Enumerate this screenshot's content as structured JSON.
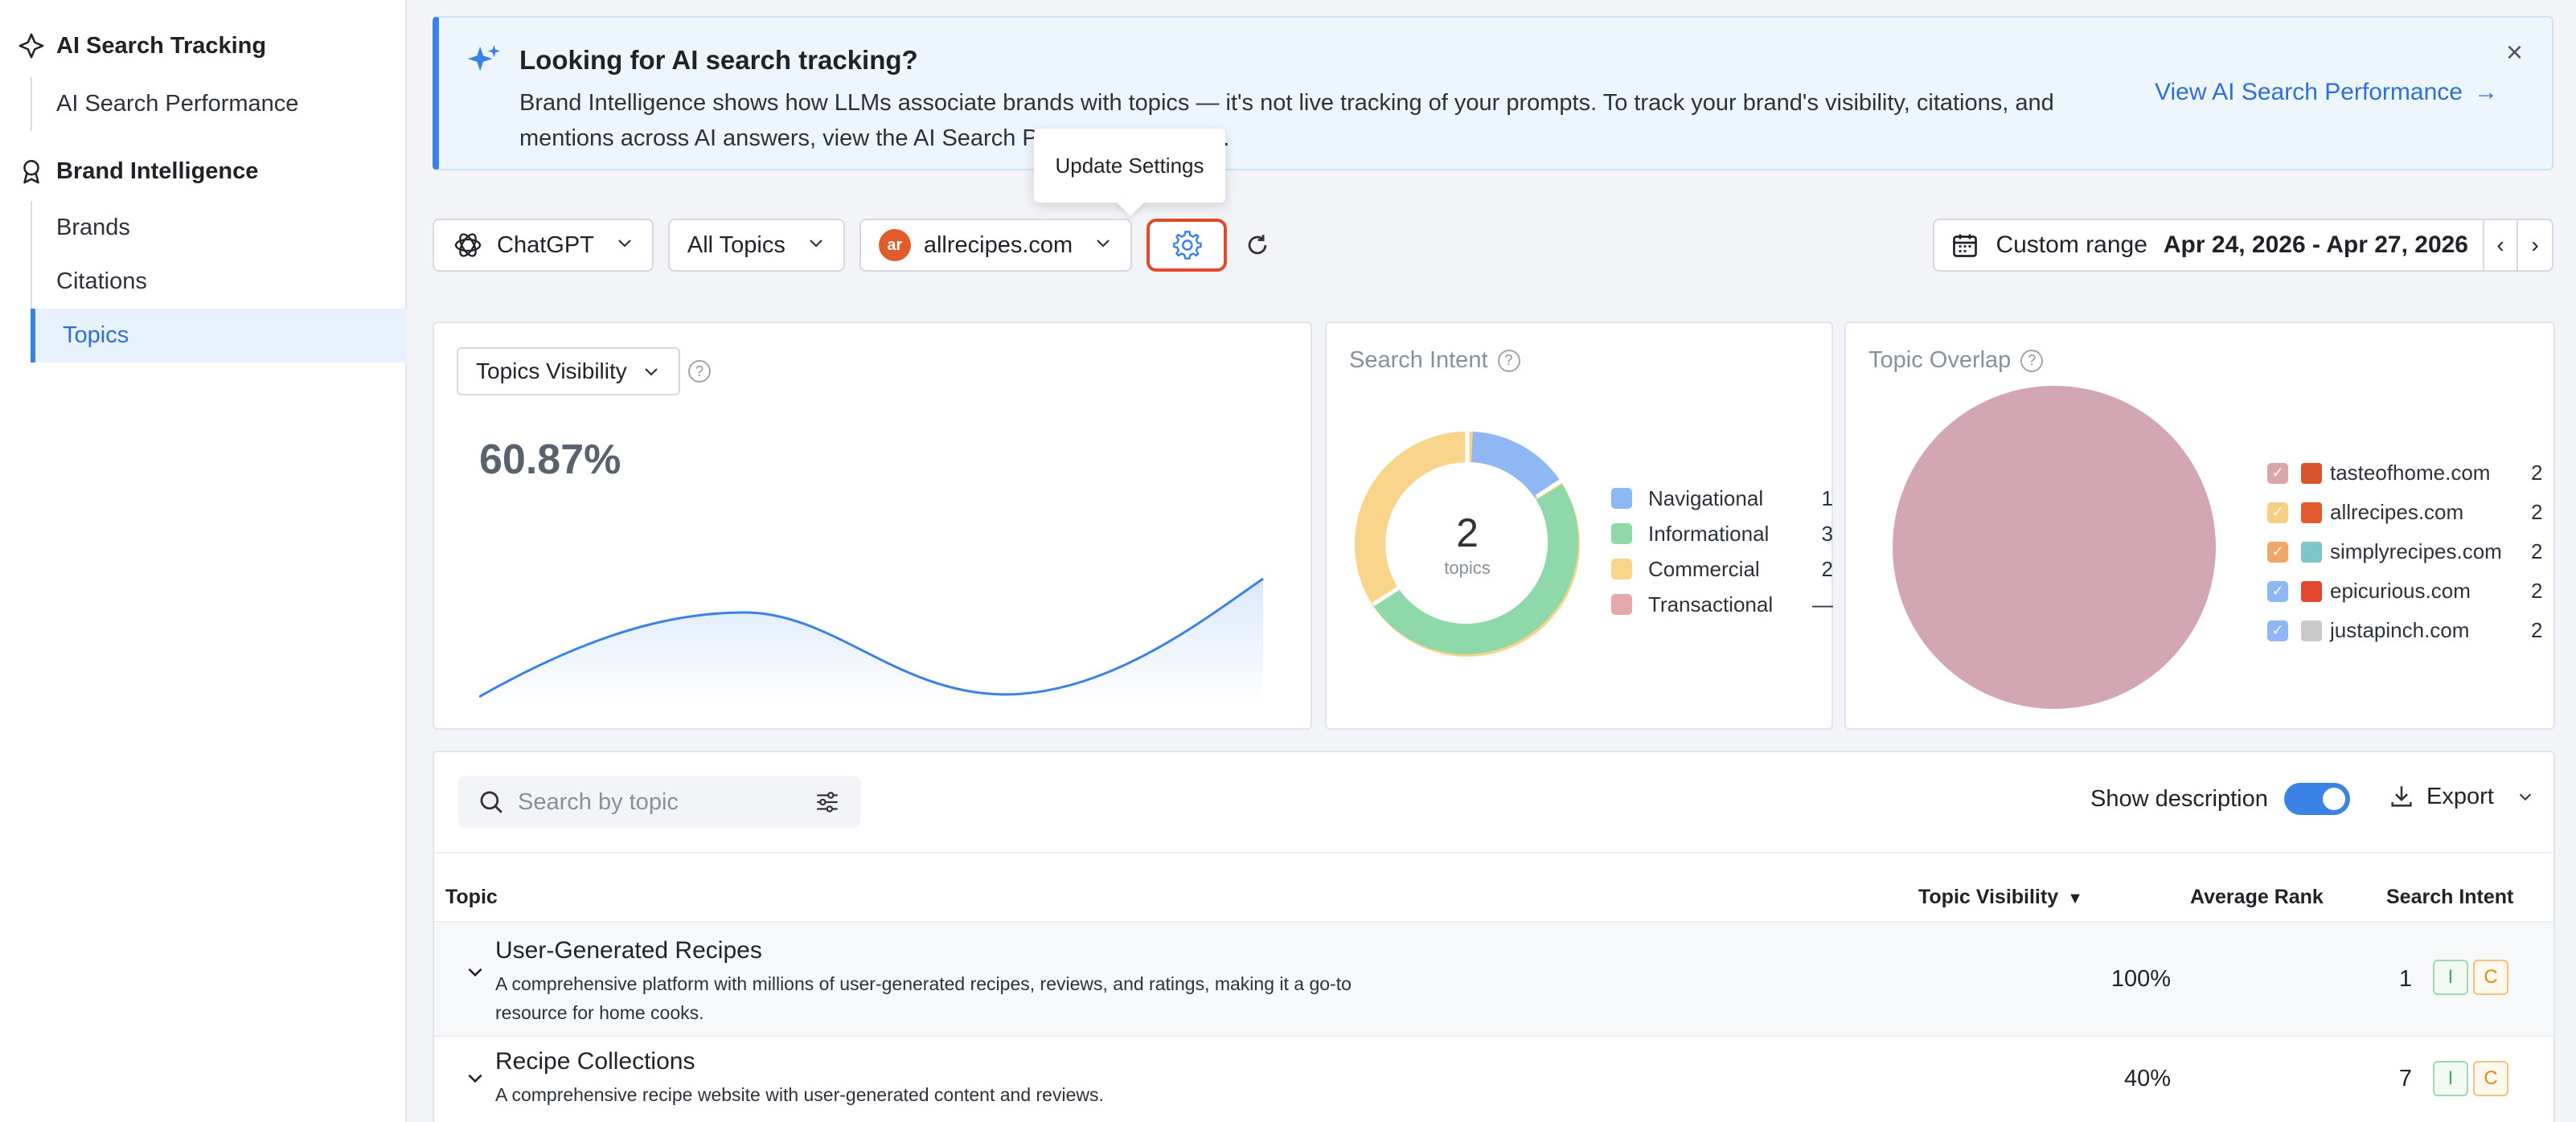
{
  "sidebar": {
    "group1": "AI Search Tracking",
    "group1_items": [
      "AI Search Performance"
    ],
    "group2": "Brand Intelligence",
    "group2_items": [
      "Brands",
      "Citations",
      "Topics"
    ],
    "active": "Topics"
  },
  "banner": {
    "title": "Looking for AI search tracking?",
    "text": "Brand Intelligence shows how LLMs associate brands with topics — it's not live tracking of your prompts. To track your brand's visibility, citations, and mentions across AI answers, view the AI Search Performance report.",
    "link": "View AI Search Performance",
    "link_arrow": "→",
    "close": "×"
  },
  "tooltip": "Update Settings",
  "toolbar": {
    "model": "ChatGPT",
    "topics": "All Topics",
    "domain": "allrecipes.com",
    "domain_logo": "ar"
  },
  "daterange": {
    "label": "Custom range",
    "value": "Apr 24, 2026 - Apr 27, 2026",
    "prev": "‹",
    "next": "›"
  },
  "visibility_card": {
    "selector": "Topics Visibility",
    "value": "60.87%"
  },
  "intent_card": {
    "title": "Search Intent",
    "center_value": "2",
    "center_label": "topics",
    "legend": [
      {
        "label": "Navigational",
        "count": "1",
        "color": "#8fb7f3"
      },
      {
        "label": "Informational",
        "count": "3",
        "color": "#8ed8aa"
      },
      {
        "label": "Commercial",
        "count": "2",
        "color": "#f9d58b"
      },
      {
        "label": "Transactional",
        "count": "—",
        "color": "#e6a9ab"
      }
    ]
  },
  "overlap_card": {
    "title": "Topic Overlap",
    "pie_color": "#d3a6b4",
    "domains": [
      {
        "name": "tasteofhome.com",
        "count": "2",
        "cb_color": "#d8a7ad",
        "fav_color": "#d9532c"
      },
      {
        "name": "allrecipes.com",
        "count": "2",
        "cb_color": "#f5cf83",
        "fav_color": "#e25b2d"
      },
      {
        "name": "simplyrecipes.com",
        "count": "2",
        "cb_color": "#f0a869",
        "fav_color": "#7fc4c9"
      },
      {
        "name": "epicurious.com",
        "count": "2",
        "cb_color": "#8fb7f3",
        "fav_color": "#e5462f"
      },
      {
        "name": "justapinch.com",
        "count": "2",
        "cb_color": "#8fb7f3",
        "fav_color": "#c9c9c9"
      }
    ]
  },
  "table": {
    "search_placeholder": "Search by topic",
    "show_description": "Show description",
    "export": "Export",
    "columns": {
      "topic": "Topic",
      "visibility": "Topic Visibility",
      "rank": "Average Rank",
      "intent": "Search Intent"
    },
    "rows": [
      {
        "name": "User-Generated Recipes",
        "description": "A comprehensive platform with millions of user-generated recipes, reviews, and ratings, making it a go-to resource for home cooks.",
        "visibility": "100%",
        "rank": "1",
        "intents": [
          "I",
          "C"
        ]
      },
      {
        "name": "Recipe Collections",
        "description": "A comprehensive recipe website with user-generated content and reviews.",
        "visibility": "40%",
        "rank": "7",
        "intents": [
          "I",
          "C"
        ]
      }
    ]
  }
}
